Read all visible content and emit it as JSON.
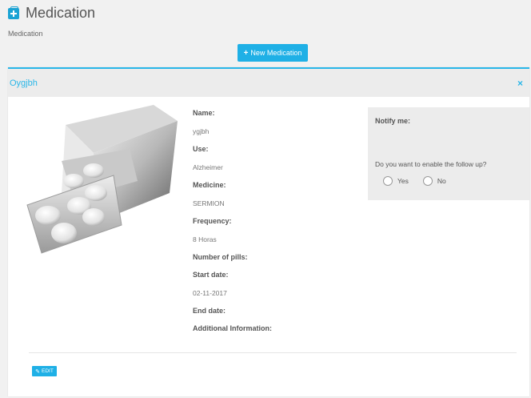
{
  "header": {
    "title": "Medication",
    "icon": "medical-kit-icon"
  },
  "breadcrumb": "Medication",
  "toolbar": {
    "new_label": "New Medication",
    "plus_glyph": "+"
  },
  "card": {
    "title": "Oygjbh",
    "close_glyph": "×",
    "fields": [
      {
        "label": "Name:",
        "value": "ygjbh"
      },
      {
        "label": "Use:",
        "value": "Alzheimer"
      },
      {
        "label": "Medicine:",
        "value": "SERMION"
      },
      {
        "label": "Frequency:",
        "value": "8 Horas"
      },
      {
        "label": "Number of pills:",
        "value": ""
      },
      {
        "label": "Start date:",
        "value": "02-11-2017"
      },
      {
        "label": "End date:",
        "value": ""
      },
      {
        "label": "Additional Information:",
        "value": ""
      }
    ],
    "notify": {
      "title": "Notify me:",
      "question": "Do you want to enable the follow up?",
      "yes": "Yes",
      "no": "No"
    },
    "edit_label": "EDIT"
  },
  "colors": {
    "accent": "#1fb0e6",
    "header_bg": "#ececec"
  }
}
